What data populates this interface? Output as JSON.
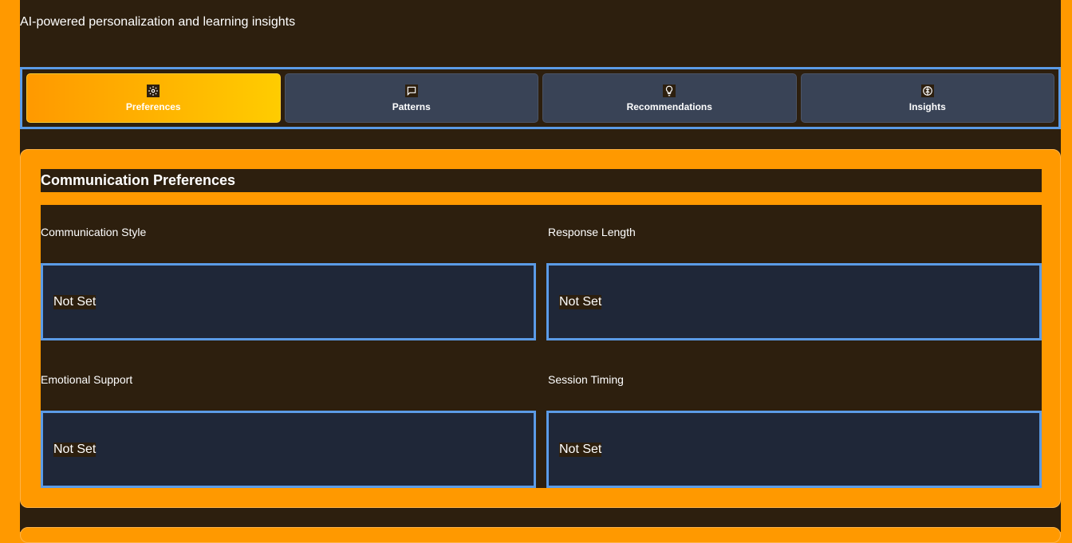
{
  "header": {
    "subtitle": "AI-powered personalization and learning insights"
  },
  "tabs": [
    {
      "label": "Preferences",
      "icon": "gear-icon",
      "active": true
    },
    {
      "label": "Patterns",
      "icon": "chat-bubble-icon",
      "active": false
    },
    {
      "label": "Recommendations",
      "icon": "lightbulb-icon",
      "active": false
    },
    {
      "label": "Insights",
      "icon": "brain-icon",
      "active": false
    }
  ],
  "section": {
    "title": "Communication Preferences",
    "fields": [
      {
        "label": "Communication Style",
        "value": "Not Set"
      },
      {
        "label": "Response Length",
        "value": "Not Set"
      },
      {
        "label": "Emotional Support",
        "value": "Not Set"
      },
      {
        "label": "Session Timing",
        "value": "Not Set"
      }
    ]
  },
  "colors": {
    "accent": "#ff9900",
    "accent_light": "#ffcc00",
    "background": "#2d1f0e",
    "tab_inactive": "#394356",
    "field_bg": "#1f2738",
    "focus_border": "#5b9be6"
  }
}
